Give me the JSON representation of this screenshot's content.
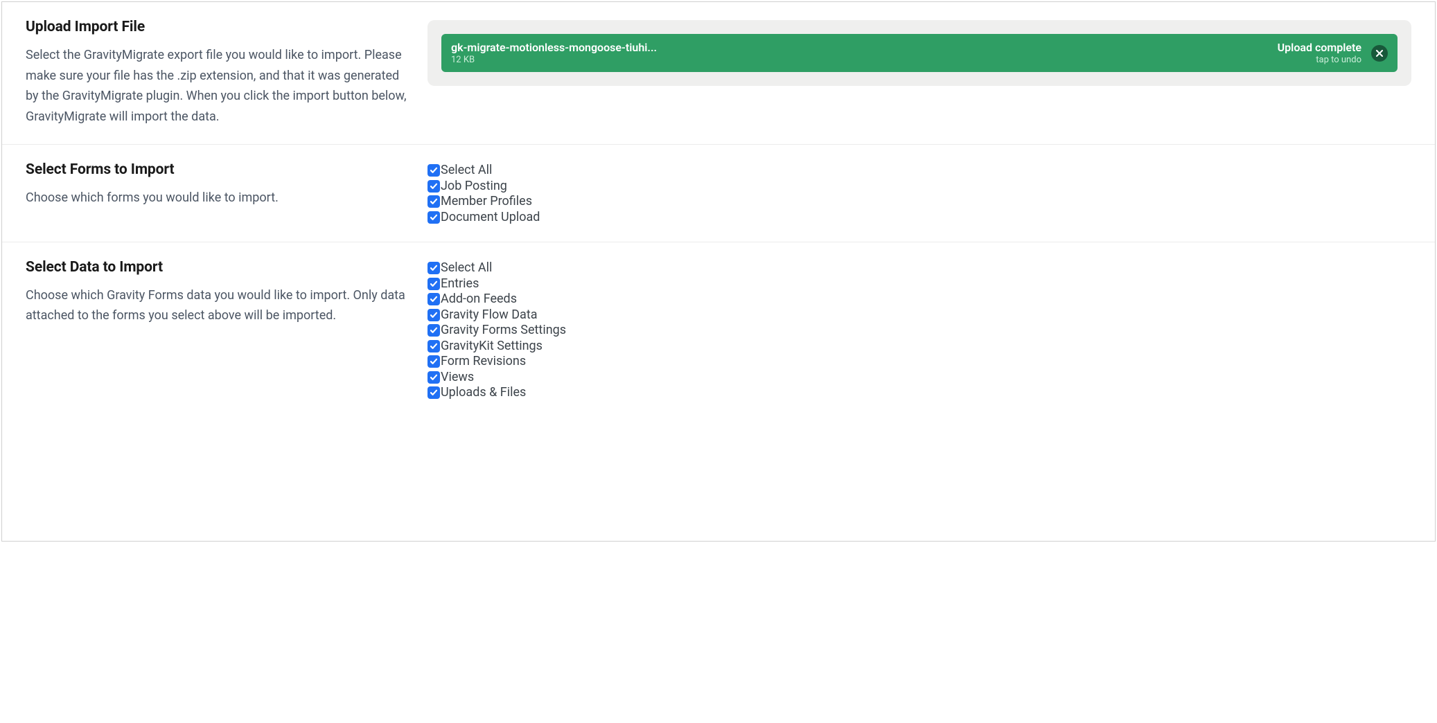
{
  "section_upload": {
    "heading": "Upload Import File",
    "description": "Select the GravityMigrate export file you would like to import. Please make sure your file has the .zip extension, and that it was generated by the GravityMigrate plugin. When you click the import button below, GravityMigrate will import the data.",
    "file": {
      "name": "gk-migrate-motionless-mongoose-tiuhi...",
      "size": "12 KB",
      "status": "Upload complete",
      "undo": "tap to undo"
    }
  },
  "section_forms": {
    "heading": "Select Forms to Import",
    "description": "Choose which forms you would like to import.",
    "items": [
      "Select All",
      "Job Posting",
      "Member Profiles",
      "Document Upload"
    ]
  },
  "section_data": {
    "heading": "Select Data to Import",
    "description": "Choose which Gravity Forms data you would like to import. Only data attached to the forms you select above will be imported.",
    "items": [
      "Select All",
      "Entries",
      "Add-on Feeds",
      "Gravity Flow Data",
      "Gravity Forms Settings",
      "GravityKit Settings",
      "Form Revisions",
      "Views",
      "Uploads & Files"
    ]
  }
}
